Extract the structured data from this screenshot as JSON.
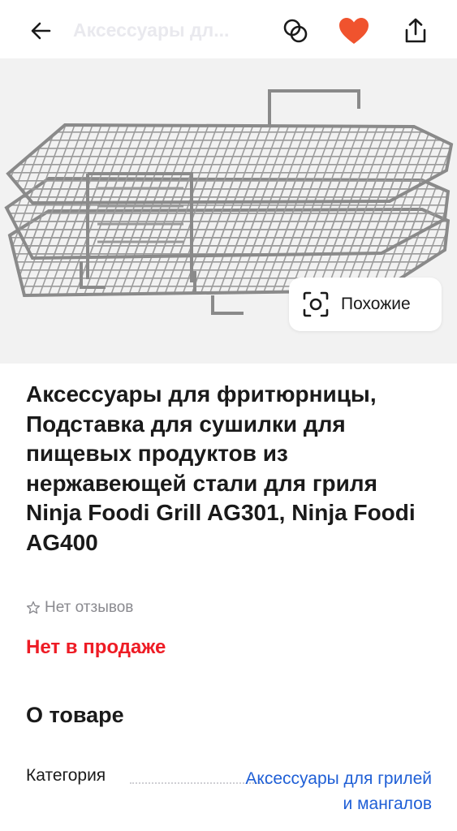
{
  "header": {
    "title": "Аксессуары дл...",
    "back_icon": "arrow-left-icon",
    "compare_icon": "compare-icon",
    "favorite_icon": "heart-icon",
    "share_icon": "share-icon",
    "favorite_color": "#f0532e"
  },
  "gallery": {
    "image_alt": "Stainless steel three-tier grill rack",
    "similar_label": "Похожие",
    "similar_icon": "visual-search-icon"
  },
  "product": {
    "title": "Аксессуары для фритюрницы, Подставка для сушилки для пищевых продуктов из нержавеющей стали для гриля Ninja Foodi Grill AG301, Ninja Foodi AG400",
    "rating_icon": "star-outline-icon",
    "reviews_text": "Нет отзывов",
    "availability": "Нет в продаже",
    "availability_color": "#ee1c25"
  },
  "about": {
    "section_title": "О товаре",
    "specs": [
      {
        "key": "Категория",
        "value": "Аксессуары для грилей и мангалов",
        "link_color": "#1f5fd6"
      }
    ]
  }
}
